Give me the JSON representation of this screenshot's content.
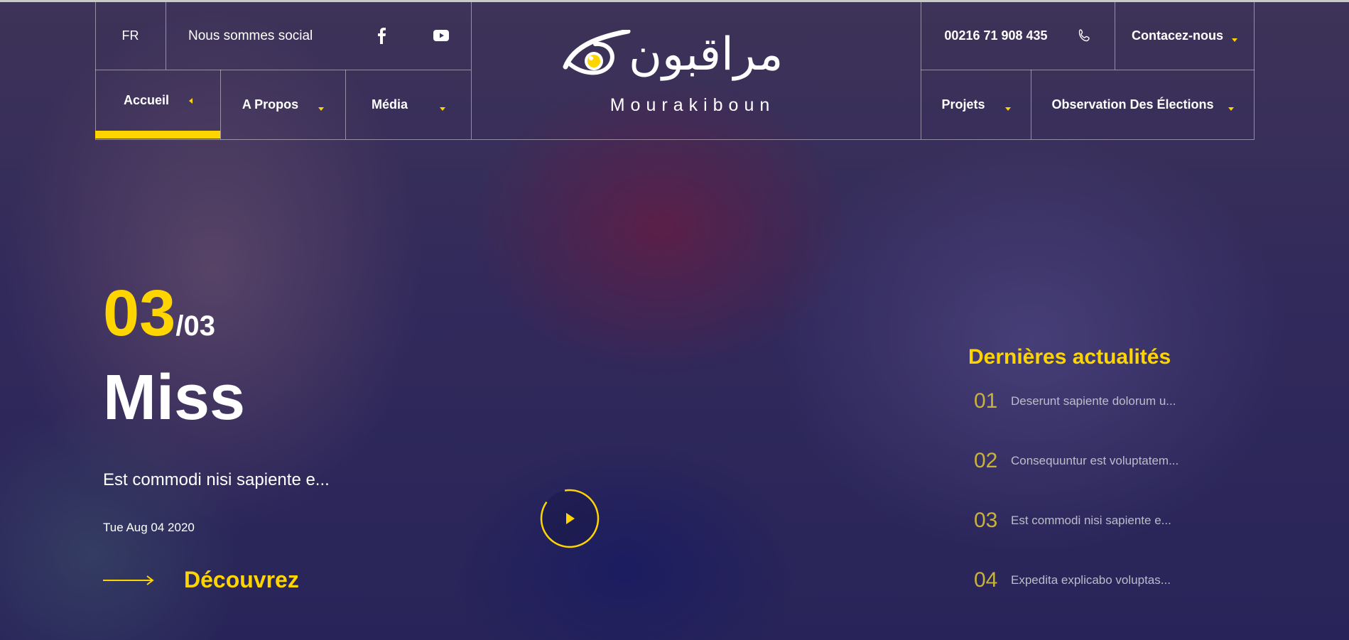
{
  "header": {
    "language": "FR",
    "social_text": "Nous sommes social",
    "phone": "00216 71 908 435",
    "contact_label": "Contacez-nous",
    "nav": {
      "home": "Accueil",
      "about": "A Propos",
      "media": "Média",
      "projects": "Projets",
      "elections": "Observation Des Élections"
    }
  },
  "logo": {
    "arabic": "مراقبون",
    "latin": "Mourakiboun"
  },
  "hero": {
    "slide_current": "03",
    "slide_total": "/03",
    "title": "Miss",
    "excerpt": "Est commodi nisi sapiente e...",
    "date": "Tue Aug 04 2020",
    "discover_label": "Découvrez"
  },
  "news": {
    "title": "Dernières actualités",
    "items": [
      {
        "num": "01",
        "text": "Deserunt sapiente dolorum u..."
      },
      {
        "num": "02",
        "text": "Consequuntur est voluptatem..."
      },
      {
        "num": "03",
        "text": "Est commodi nisi sapiente e..."
      },
      {
        "num": "04",
        "text": "Expedita explicabo voluptas..."
      }
    ]
  },
  "colors": {
    "accent": "#ffd500",
    "overlay": "#2e2a63"
  }
}
